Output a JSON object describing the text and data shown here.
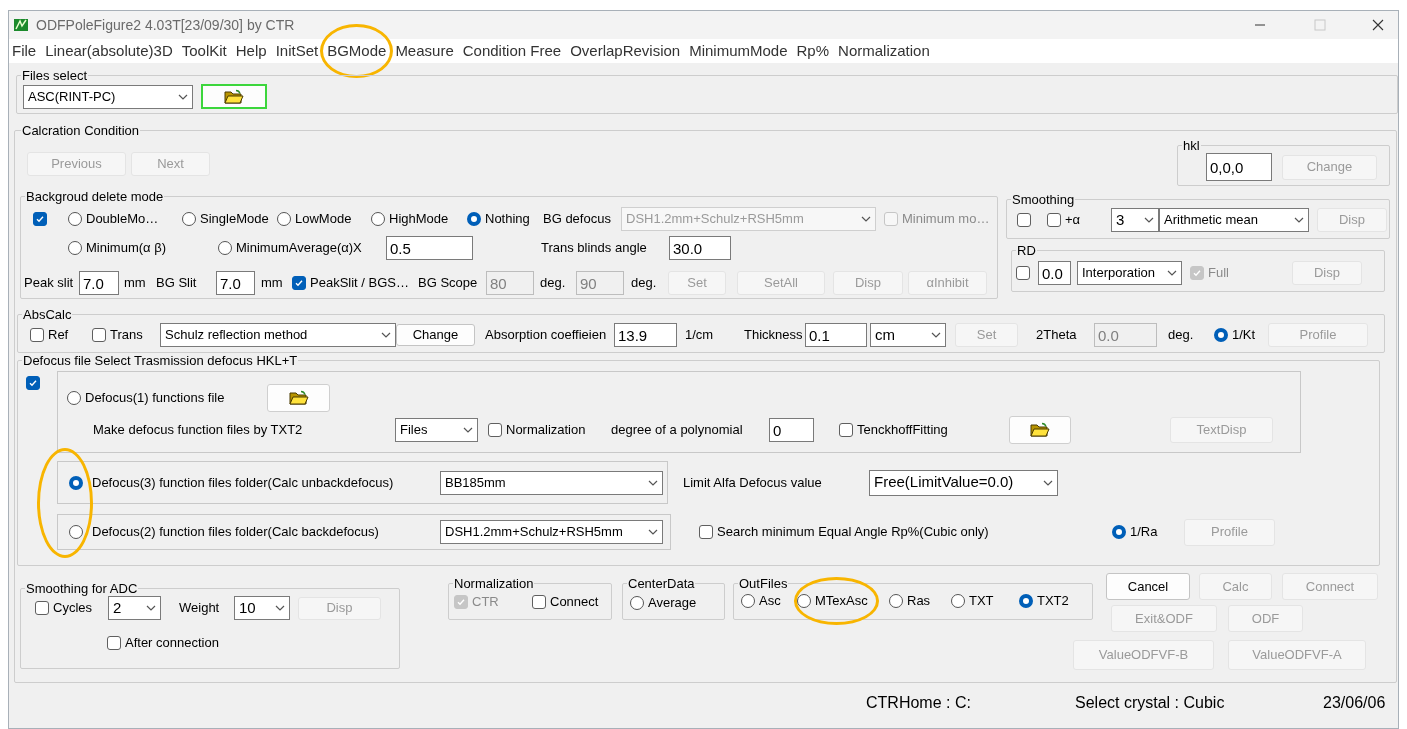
{
  "window": {
    "title": "ODFPoleFigure2 4.03T[23/09/30] by CTR"
  },
  "menu": [
    {
      "label": "File",
      "highlighted": false
    },
    {
      "label": "Linear(absolute)3D",
      "highlighted": false
    },
    {
      "label": "ToolKit",
      "highlighted": false
    },
    {
      "label": "Help",
      "highlighted": false
    },
    {
      "label": "InitSet",
      "highlighted": false
    },
    {
      "label": "BGMode",
      "highlighted": true
    },
    {
      "label": "Measure",
      "highlighted": false
    },
    {
      "label": "Condition Free",
      "highlighted": false
    },
    {
      "label": "OverlapRevision",
      "highlighted": false
    },
    {
      "label": "MinimumMode",
      "highlighted": false
    },
    {
      "label": "Rp%",
      "highlighted": false
    },
    {
      "label": "Normalization",
      "highlighted": false
    }
  ],
  "files_select": {
    "title": "Files select",
    "format": "ASC(RINT-PC)",
    "open_button": {
      "focused": true
    }
  },
  "calc_condition": {
    "title": "Calcration Condition",
    "previous": {
      "label": "Previous",
      "disabled": true
    },
    "next": {
      "label": "Next",
      "disabled": true
    }
  },
  "hkl": {
    "title": "hkl",
    "value": "0,0,0",
    "change": {
      "label": "Change",
      "disabled": true
    }
  },
  "background_delete": {
    "title": "Backgroud delete mode",
    "checked": true,
    "modes": [
      {
        "label": "DoubleMo…",
        "selected": false
      },
      {
        "label": "SingleMode",
        "selected": false
      },
      {
        "label": "LowMode",
        "selected": false
      },
      {
        "label": "HighMode",
        "selected": false
      },
      {
        "label": "Nothing",
        "selected": true
      },
      {
        "label": "Minimum(α β)",
        "selected": false
      },
      {
        "label": "MinimumAverage(α)X",
        "selected": false
      }
    ],
    "bg_defocus_label": "BG defocus",
    "bg_defocus": {
      "value": "DSH1.2mm+Schulz+RSH5mm",
      "disabled": true
    },
    "minimum_mode": {
      "label": "Minimum mo…",
      "checked": false,
      "disabled": true
    },
    "factor": "0.5",
    "trans_blinds_label": "Trans blinds angle",
    "trans_blinds": "30.0",
    "peak_slit_label": "Peak slit",
    "peak_slit": "7.0",
    "peak_slit_unit": "mm",
    "bg_slit_label": "BG Slit",
    "bg_slit": "7.0",
    "bg_slit_unit": "mm",
    "peak_bg_ratio": {
      "label": "PeakSlit / BGS…",
      "checked": true
    },
    "bg_scope_label": "BG Scope",
    "bg_scope_from": {
      "value": "80",
      "disabled": true
    },
    "from_unit": "deg.",
    "bg_scope_to": {
      "value": "90",
      "disabled": true
    },
    "to_unit": "deg.",
    "buttons": [
      {
        "label": "Set",
        "disabled": true
      },
      {
        "label": "SetAll",
        "disabled": true
      },
      {
        "label": "Disp",
        "disabled": true
      },
      {
        "label": "αInhibit",
        "disabled": true
      }
    ]
  },
  "smoothing": {
    "title": "Smoothing",
    "checked": false,
    "plus_alpha": {
      "label": "+α",
      "checked": false
    },
    "count": "3",
    "method": "Arithmetic mean",
    "disp": {
      "label": "Disp",
      "disabled": true
    }
  },
  "rd": {
    "title": "RD",
    "checked": false,
    "value": "0.0",
    "method": "Interporation",
    "full": {
      "label": "Full",
      "checked": true,
      "disabled": true
    },
    "disp": {
      "label": "Disp",
      "disabled": true
    }
  },
  "abs_calc": {
    "title": "AbsCalc",
    "ref": {
      "label": "Ref",
      "checked": false
    },
    "trans": {
      "label": "Trans",
      "checked": false
    },
    "method": "Schulz reflection method",
    "change": {
      "label": "Change",
      "disabled": false
    },
    "coefficient_label": "Absorption coeffieien",
    "coefficient": "13.9",
    "coefficient_unit": "1/cm",
    "thickness_label": "Thickness",
    "thickness": "0.1",
    "thickness_unit": "cm",
    "set": {
      "label": "Set",
      "disabled": true
    },
    "two_theta_label": "2Theta",
    "two_theta": {
      "value": "0.0",
      "disabled": true
    },
    "two_theta_unit": "deg.",
    "kt": {
      "label": "1/Kt",
      "selected": true
    },
    "profile": {
      "label": "Profile",
      "disabled": true
    }
  },
  "defocus": {
    "title": "Defocus file Select Trasmission defocus HKL+T",
    "checked": true,
    "option1": {
      "label": "Defocus(1) functions file",
      "selected": false
    },
    "make_label": "Make defocus function files by TXT2",
    "source": "Files",
    "normalization": {
      "label": "Normalization",
      "checked": false
    },
    "degree_label": "degree of a polynomial",
    "degree": "0",
    "tenckhoff": {
      "label": "TenckhoffFitting",
      "checked": false
    },
    "text_disp": {
      "label": "TextDisp",
      "disabled": true
    },
    "option3": {
      "label": "Defocus(3) function files folder(Calc unbackdefocus)",
      "selected": true,
      "folder": "BB185mm",
      "highlighted": true
    },
    "limit_label": "Limit Alfa Defocus value",
    "limit": "Free(LimitValue=0.0)",
    "option2": {
      "label": "Defocus(2) function files folder(Calc backdefocus)",
      "selected": false,
      "folder": "DSH1.2mm+Schulz+RSH5mm"
    },
    "search": {
      "label": "Search minimum Equal Angle Rp%(Cubic only)",
      "checked": false
    },
    "ra": {
      "label": "1/Ra",
      "selected": true
    },
    "profile": {
      "label": "Profile",
      "disabled": true
    }
  },
  "smoothing_adc": {
    "title": "Smoothing for ADC",
    "cycles": {
      "label": "Cycles",
      "checked": false
    },
    "cycles_value": "2",
    "weight_label": "Weight",
    "weight": "10",
    "disp": {
      "label": "Disp",
      "disabled": true
    },
    "after_connection": {
      "label": "After connection",
      "checked": false
    }
  },
  "normalization": {
    "title": "Normalization",
    "ctr": {
      "label": "CTR",
      "checked": true,
      "disabled": true
    },
    "connect": {
      "label": "Connect",
      "checked": false
    }
  },
  "center_data": {
    "title": "CenterData",
    "average": {
      "label": "Average",
      "selected": false
    }
  },
  "out_files": {
    "title": "OutFiles",
    "options": [
      {
        "label": "Asc",
        "selected": false,
        "highlighted": false
      },
      {
        "label": "MTexAsc",
        "selected": false,
        "highlighted": true
      },
      {
        "label": "Ras",
        "selected": false,
        "highlighted": false
      },
      {
        "label": "TXT",
        "selected": false,
        "highlighted": false
      },
      {
        "label": "TXT2",
        "selected": true,
        "highlighted": false
      }
    ]
  },
  "actions": [
    {
      "label": "Cancel",
      "disabled": false
    },
    {
      "label": "Calc",
      "disabled": true
    },
    {
      "label": "Connect",
      "disabled": true
    },
    {
      "label": "Exit&ODF",
      "disabled": true
    },
    {
      "label": "ODF",
      "disabled": true
    },
    {
      "label": "ValueODFVF-B",
      "disabled": true
    },
    {
      "label": "ValueODFVF-A",
      "disabled": true
    }
  ],
  "status_bar": [
    "CTRHome : C:",
    "Select crystal : Cubic",
    "23/06/06"
  ]
}
